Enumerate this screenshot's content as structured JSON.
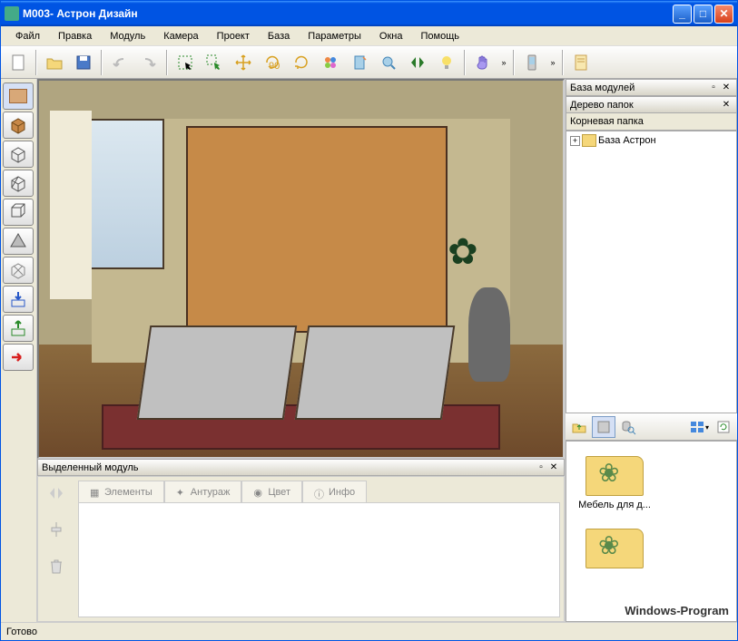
{
  "title": "М003- Астрон Дизайн",
  "menu": [
    "Файл",
    "Правка",
    "Модуль",
    "Камера",
    "Проект",
    "База",
    "Параметры",
    "Окна",
    "Помощь"
  ],
  "toolbar": {
    "icons": [
      "new",
      "open",
      "save",
      "undo",
      "redo",
      "select-rect",
      "select-cursor",
      "move",
      "rotate90",
      "rotate",
      "flower",
      "mirror-door",
      "zoom-fit",
      "flip",
      "bulb",
      "hand",
      "phone",
      "page"
    ]
  },
  "left_tools": [
    "texture",
    "cube-solid",
    "cube-wire",
    "cube-persp",
    "cube-ortho",
    "triangle",
    "cube-disable",
    "arrow-down",
    "arrow-up-green",
    "arrow-right-red"
  ],
  "viewport": {
    "scene": "bedroom"
  },
  "bottom_panel": {
    "title": "Выделенный модуль",
    "tabs": [
      "Элементы",
      "Антураж",
      "Цвет",
      "Инфо"
    ]
  },
  "right": {
    "modules_title": "База модулей",
    "tree_title": "Дерево папок",
    "root_label": "Корневая папка",
    "tree_item": "База Астрон",
    "thumb_label": "Мебель для д..."
  },
  "status": "Готово",
  "watermark": "Windows-Program"
}
